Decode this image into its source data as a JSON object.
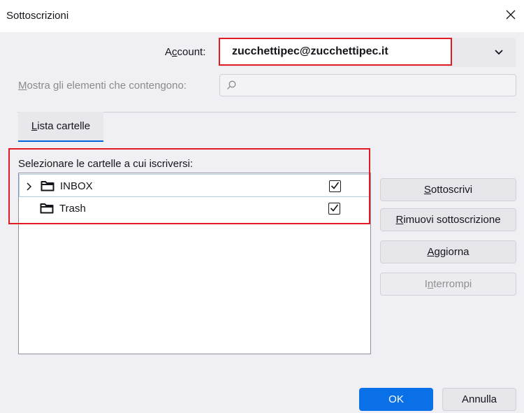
{
  "window": {
    "title": "Sottoscrizioni"
  },
  "account": {
    "label_pre": "A",
    "label_key": "c",
    "label_post": "count:",
    "value": "zucchettipec@zucchettipec.it"
  },
  "filter": {
    "label_key": "M",
    "label_post": "ostra gli elementi che contengono:",
    "value": ""
  },
  "tab": {
    "label_key": "L",
    "label_post": "ista cartelle"
  },
  "tree": {
    "label": "Selezionare le cartelle a cui iscriversi:",
    "folders": [
      {
        "name": "INBOX",
        "subscribed": true,
        "expandable": true
      },
      {
        "name": "Trash",
        "subscribed": true,
        "expandable": false
      }
    ]
  },
  "actions": {
    "subscribe": {
      "key": "S",
      "rest": "ottoscrivi"
    },
    "unsubscribe": {
      "key": "R",
      "rest": "imuovi sottoscrizione"
    },
    "refresh": {
      "key": "A",
      "rest": "ggiorna"
    },
    "stop": {
      "pre": "I",
      "key": "n",
      "rest": "terrompi",
      "disabled": true
    }
  },
  "footer": {
    "ok": "OK",
    "cancel": "Annulla"
  }
}
